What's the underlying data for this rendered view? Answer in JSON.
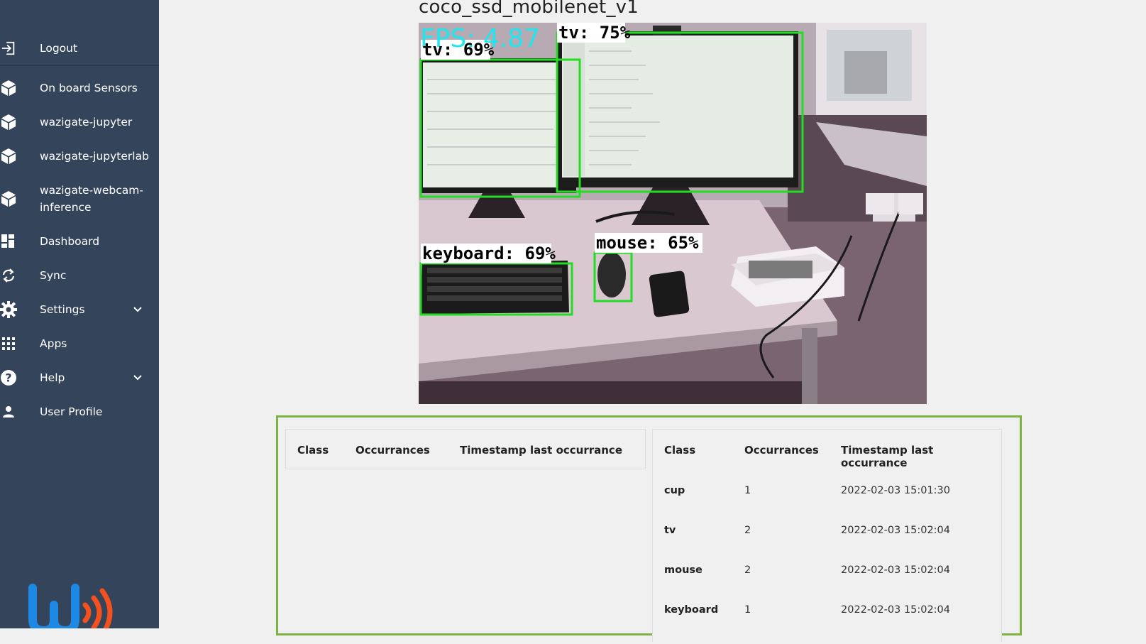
{
  "sidebar": {
    "items": [
      {
        "label": "Logout",
        "icon": "logout-icon"
      },
      {
        "label": "On board Sensors",
        "icon": "cube-icon"
      },
      {
        "label": "wazigate-jupyter",
        "icon": "cube-icon"
      },
      {
        "label": "wazigate-jupyterlab",
        "icon": "cube-icon"
      },
      {
        "label": "wazigate-webcam-",
        "label2": "inference",
        "icon": "cube-icon"
      },
      {
        "label": "Dashboard",
        "icon": "dashboard-icon"
      },
      {
        "label": "Sync",
        "icon": "sync-icon"
      },
      {
        "label": "Settings",
        "icon": "gear-icon"
      },
      {
        "label": "Apps",
        "icon": "apps-grid-icon"
      },
      {
        "label": "Help",
        "icon": "help-icon"
      },
      {
        "label": "User Profile",
        "icon": "user-icon"
      }
    ]
  },
  "main": {
    "model_name": "coco_ssd_mobilenet_v1",
    "camera": {
      "fps_text": "FPS: 4.87",
      "detections": [
        {
          "label": "tv: 69%"
        },
        {
          "label": "tv: 75%"
        },
        {
          "label": "keyboard: 69%"
        },
        {
          "label": "mouse: 65%"
        }
      ]
    },
    "tables": {
      "left": {
        "headers": [
          "Class",
          "Occurrances",
          "Timestamp last occurrance"
        ],
        "rows": []
      },
      "right": {
        "headers": [
          "Class",
          "Occurrances",
          "Timestamp last occurrance"
        ],
        "rows": [
          {
            "class": "cup",
            "count": "1",
            "timestamp": "2022-02-03 15:01:30"
          },
          {
            "class": "tv",
            "count": "2",
            "timestamp": "2022-02-03 15:02:04"
          },
          {
            "class": "mouse",
            "count": "2",
            "timestamp": "2022-02-03 15:02:04"
          },
          {
            "class": "keyboard",
            "count": "1",
            "timestamp": "2022-02-03 15:02:04"
          }
        ]
      }
    }
  },
  "colors": {
    "sidebar_bg": "#34445a",
    "panel_border": "#7cb342",
    "detection_box": "#22dd22",
    "fps_text": "#22e6ee",
    "logo_blue": "#1e88e5",
    "logo_orange": "#f4511e"
  }
}
